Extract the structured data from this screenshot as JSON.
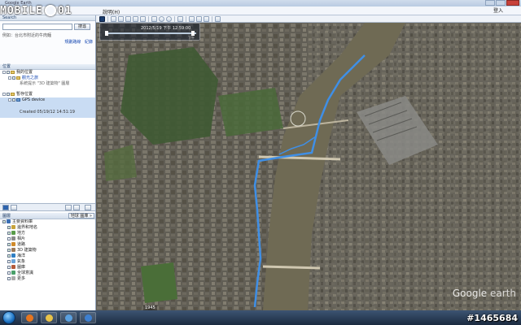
{
  "window": {
    "title": "Google Earth"
  },
  "logo": {
    "text_left": "MOBILE",
    "text_right": "01"
  },
  "menu": {
    "help": "說明(H)",
    "login": "登入"
  },
  "search": {
    "header": "Search",
    "placeholder": "",
    "button": "搜尋",
    "hint": "例如：台北市附近的牛肉麵",
    "link_directions": "規劃路線",
    "link_history": "紀錄"
  },
  "places": {
    "header": "位置",
    "items": [
      {
        "label": "我的位置",
        "kind": "folder",
        "checked": true
      },
      {
        "label": "觀光之旅",
        "kind": "link",
        "checked": true
      },
      {
        "label": "系統提示 \"3D 建築物\" 圖層",
        "kind": "text",
        "checked": false
      },
      {
        "label": "暫存位置",
        "kind": "folder",
        "checked": true
      },
      {
        "label": "GPS device",
        "kind": "item",
        "checked": true
      }
    ],
    "selected_timestamp": "Created 05/19/12 14:51:19"
  },
  "layers": {
    "header": "圖層",
    "gallery_button": "地球 圖庫 »",
    "items": [
      {
        "label": "主要資料庫",
        "color": "#3a6fb5",
        "checked": true
      },
      {
        "label": "邊界和地名",
        "color": "#c7a33a",
        "checked": true
      },
      {
        "label": "地方",
        "color": "#5a9c4a",
        "checked": true
      },
      {
        "label": "相片",
        "color": "#8a8a8a",
        "checked": false
      },
      {
        "label": "道路",
        "color": "#d08a2a",
        "checked": true
      },
      {
        "label": "3D 建築物",
        "color": "#9b7a5a",
        "checked": true
      },
      {
        "label": "海洋",
        "color": "#2f7fc4",
        "checked": true
      },
      {
        "label": "氣象",
        "color": "#6aa3d8",
        "checked": false
      },
      {
        "label": "圖庫",
        "color": "#b35a3a",
        "checked": false
      },
      {
        "label": "全球意識",
        "color": "#4aa06a",
        "checked": false
      },
      {
        "label": "更多",
        "color": "#aaaaaa",
        "checked": false
      }
    ]
  },
  "map": {
    "time_label": "2012/5/19 下午 12:59:00",
    "time_start": "",
    "time_end": "下午",
    "status": "1945",
    "brand_google": "Google",
    "brand_earth": " earth"
  },
  "taskbar": {
    "apps": [
      {
        "name": "firefox",
        "color": "#e6761f"
      },
      {
        "name": "explorer",
        "color": "#e8c34a"
      },
      {
        "name": "media",
        "color": "#5aa0e0"
      },
      {
        "name": "earth",
        "color": "#3d7fd0"
      }
    ],
    "tray": ""
  },
  "watermark": "#1465684",
  "colors": {
    "route": "#3f8fe6",
    "river": "#6f6a54"
  }
}
